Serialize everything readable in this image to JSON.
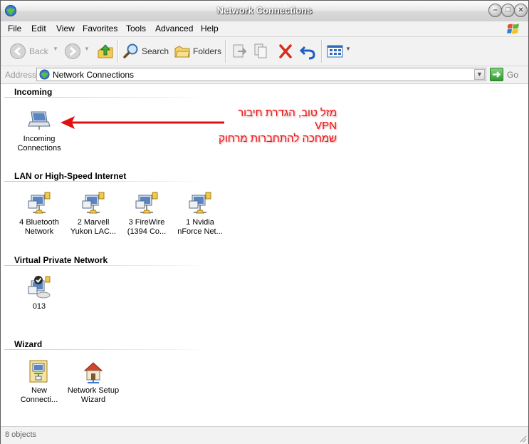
{
  "window": {
    "title": "Network Connections"
  },
  "menu": {
    "items": [
      "File",
      "Edit",
      "View",
      "Favorites",
      "Tools",
      "Advanced",
      "Help"
    ]
  },
  "toolbar": {
    "back": "Back",
    "search": "Search",
    "folders": "Folders"
  },
  "address": {
    "label": "Address",
    "value": "Network Connections",
    "go": "Go"
  },
  "groups": [
    {
      "title": "Incoming",
      "items": [
        {
          "line1": "Incoming",
          "line2": "Connections",
          "icon": "incoming-connections-icon"
        }
      ]
    },
    {
      "title": "LAN or High-Speed Internet",
      "items": [
        {
          "line1": "4 Bluetooth",
          "line2": "Network",
          "icon": "network-adapter-icon"
        },
        {
          "line1": "2 Marvell",
          "line2": "Yukon LAC...",
          "icon": "network-adapter-icon"
        },
        {
          "line1": "3 FireWire",
          "line2": "(1394 Co...",
          "icon": "network-adapter-icon"
        },
        {
          "line1": "1 Nvidia",
          "line2": "nForce Net...",
          "icon": "network-adapter-icon"
        }
      ]
    },
    {
      "title": "Virtual Private Network",
      "items": [
        {
          "line1": "013",
          "line2": "",
          "icon": "vpn-connection-icon"
        }
      ]
    },
    {
      "title": "Wizard",
      "items": [
        {
          "line1": "New",
          "line2": "Connecti...",
          "icon": "new-connection-wizard-icon"
        },
        {
          "line1": "Network Setup",
          "line2": "Wizard",
          "icon": "network-setup-wizard-icon"
        }
      ]
    }
  ],
  "annotation": {
    "line1": "מזל טוב, הגדרת חיבור",
    "line2": "VPN",
    "line3": "שמחכה להתחברות מרחוק",
    "color": "#e11111"
  },
  "status": {
    "text": "8 objects"
  }
}
